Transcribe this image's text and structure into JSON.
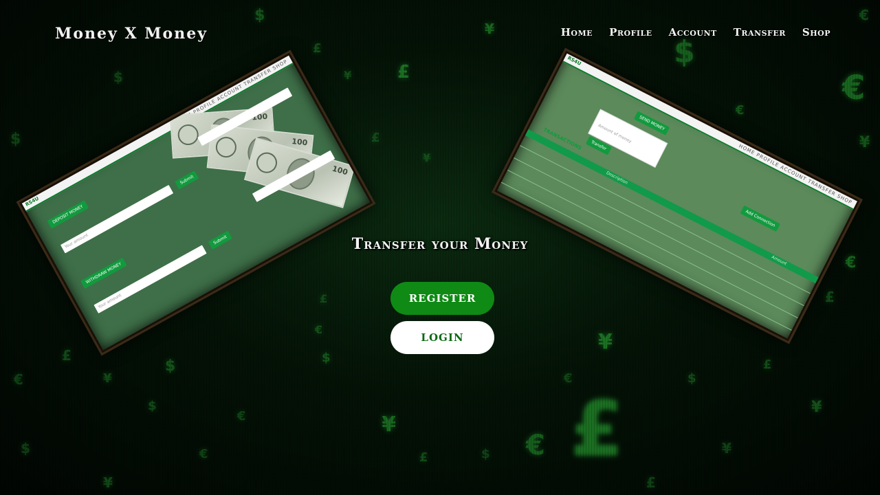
{
  "brand": "Money X Money",
  "nav": [
    "Home",
    "Profile",
    "Account",
    "Transfer",
    "Shop"
  ],
  "hero": {
    "title": "Transfer your Money",
    "register_label": "REGISTER",
    "login_label": "LOGIN"
  },
  "preview_left": {
    "brand": "RS4U",
    "nav": "HOME PROFILE ACCOUNT TRANSFER SHOP",
    "deposit_label": "DEPOSIT MONEY",
    "withdraw_label": "WITHDRAW MONEY",
    "placeholder": "Your amount",
    "submit_label": "Submit",
    "bill_number": "100"
  },
  "preview_right": {
    "brand": "RS4U",
    "nav": "HOME PROFILE ACCOUNT TRANSFER SHOP",
    "send_label": "SEND MONEY",
    "transfer_label": "Transfer",
    "add_connection_label": "Add Connection",
    "transactions_label": "TRANSACTIONS",
    "col_description": "Description",
    "col_amount": "Amount",
    "placeholder": "Amount of money"
  },
  "colors": {
    "accent": "#0f8a15",
    "background": "#020a03",
    "glyph": "#2fbf3a"
  },
  "decor": {
    "currency_glyphs": [
      "$",
      "£",
      "¥",
      "€",
      "$",
      "€",
      "£",
      "¥"
    ]
  }
}
